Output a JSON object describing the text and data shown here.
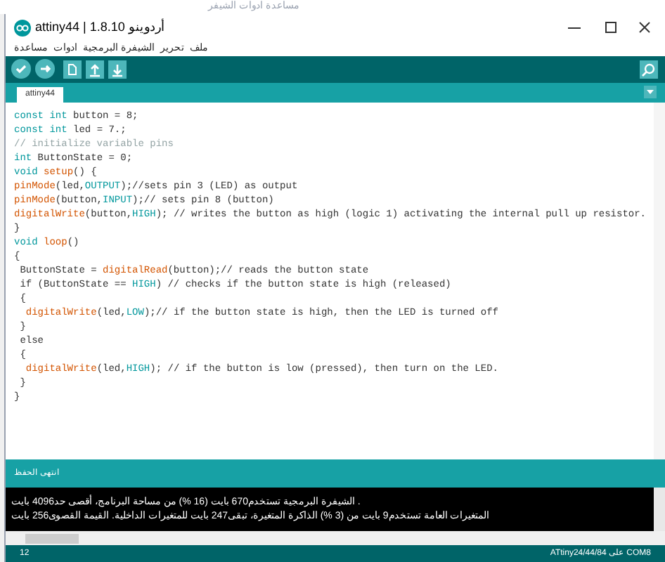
{
  "background_window": {
    "menu": "مساعدة ادوات الشيفر"
  },
  "window": {
    "title": "attiny44 | 1.8.10 أردوينو"
  },
  "menu": [
    "ملف",
    "تحرير",
    "الشيفرة البرمجية",
    "ادوات",
    "مساعدة"
  ],
  "tabs": [
    {
      "label": "attiny44",
      "selected": true
    }
  ],
  "code_lines": [
    [
      {
        "kind": "keyword",
        "text": "const int"
      },
      {
        "kind": "plain",
        "text": " button = 8;"
      }
    ],
    [
      {
        "kind": "keyword",
        "text": "const int"
      },
      {
        "kind": "plain",
        "text": " led = 7.;"
      }
    ],
    [
      {
        "kind": "comment",
        "text": "// initialize variable pins"
      }
    ],
    [
      {
        "kind": "keyword",
        "text": "int"
      },
      {
        "kind": "plain",
        "text": " ButtonState = 0;"
      }
    ],
    [
      {
        "kind": "keyword",
        "text": "void "
      },
      {
        "kind": "function",
        "text": "setup"
      },
      {
        "kind": "plain",
        "text": "() {"
      }
    ],
    [
      {
        "kind": "function",
        "text": "pinMode"
      },
      {
        "kind": "plain",
        "text": "(led,"
      },
      {
        "kind": "constant",
        "text": "OUTPUT"
      },
      {
        "kind": "plain",
        "text": ");//sets pin 3 (LED) as output"
      }
    ],
    [
      {
        "kind": "function",
        "text": "pinMode"
      },
      {
        "kind": "plain",
        "text": "(button,"
      },
      {
        "kind": "constant",
        "text": "INPUT"
      },
      {
        "kind": "plain",
        "text": ");// sets pin 8 (button)"
      }
    ],
    [
      {
        "kind": "function",
        "text": "digitalWrite"
      },
      {
        "kind": "plain",
        "text": "(button,"
      },
      {
        "kind": "constant",
        "text": "HIGH"
      },
      {
        "kind": "plain",
        "text": "); // writes the button as high (logic 1) activating the internal pull up resistor."
      }
    ],
    [
      {
        "kind": "plain",
        "text": "}"
      }
    ],
    [
      {
        "kind": "keyword",
        "text": "void "
      },
      {
        "kind": "function",
        "text": "loop"
      },
      {
        "kind": "plain",
        "text": "()"
      }
    ],
    [
      {
        "kind": "plain",
        "text": "{"
      }
    ],
    [
      {
        "kind": "plain",
        "text": " ButtonState = "
      },
      {
        "kind": "function",
        "text": "digitalRead"
      },
      {
        "kind": "plain",
        "text": "(button);// reads the button state"
      }
    ],
    [
      {
        "kind": "plain",
        "text": " if (ButtonState == "
      },
      {
        "kind": "constant",
        "text": "HIGH"
      },
      {
        "kind": "plain",
        "text": ") // checks if the button state is high (released)"
      }
    ],
    [
      {
        "kind": "plain",
        "text": " {"
      }
    ],
    [
      {
        "kind": "function",
        "text": "  digitalWrite"
      },
      {
        "kind": "plain",
        "text": "(led,"
      },
      {
        "kind": "constant",
        "text": "LOW"
      },
      {
        "kind": "plain",
        "text": ");// if the button state is high, then the LED is turned off"
      }
    ],
    [
      {
        "kind": "plain",
        "text": " }"
      }
    ],
    [
      {
        "kind": "plain",
        "text": " else"
      }
    ],
    [
      {
        "kind": "plain",
        "text": " {"
      }
    ],
    [
      {
        "kind": "function",
        "text": "  digitalWrite"
      },
      {
        "kind": "plain",
        "text": "(led,"
      },
      {
        "kind": "constant",
        "text": "HIGH"
      },
      {
        "kind": "plain",
        "text": "); // if the button is low (pressed), then turn on the LED."
      }
    ],
    [
      {
        "kind": "plain",
        "text": " }"
      }
    ],
    [
      {
        "kind": "plain",
        "text": "}"
      }
    ]
  ],
  "message": "انتهى الحفظ",
  "console_lines": [
    ". الشيفرة البرمجية تستخدم670 بايت (16 %) من مساحة البرنامج، أقصى حد4096 بايت",
    "المتغيرات العامة تستخدم9 بايت من (3 %) الذاكرة المتغيرة، تبقى247 بايت للمتغيرات الداخلية. القيمة القصوى256 بايت"
  ],
  "status_bar": {
    "line": "12",
    "board": "ATtiny24/44/84 على COM8"
  }
}
